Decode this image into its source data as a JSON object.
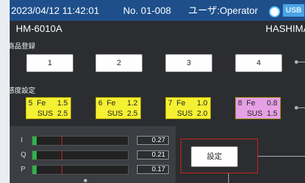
{
  "statusbar": {
    "datetime": "2023/04/12 11:42:01",
    "number": "No. 01-008",
    "user": "ユーザ:Operator",
    "usb_label": "USB"
  },
  "header": {
    "model": "HM-6010A",
    "brand": "HASHIMA"
  },
  "products": {
    "label": "商品登録",
    "buttons": [
      "1",
      "2",
      "3",
      "4"
    ]
  },
  "sensitivity": {
    "label": "感度設定",
    "items": [
      {
        "num": "5",
        "fe_label": "Fe",
        "fe": "1.5",
        "sus_label": "SUS",
        "sus": "2.5",
        "color": "#f5f032"
      },
      {
        "num": "6",
        "fe_label": "Fe",
        "fe": "1.2",
        "sus_label": "SUS",
        "sus": "2.5",
        "color": "#f5f032"
      },
      {
        "num": "7",
        "fe_label": "Fe",
        "fe": "1.0",
        "sus_label": "SUS",
        "sus": "2.0",
        "color": "#f5f032"
      },
      {
        "num": "8",
        "fe_label": "Fe",
        "fe": "0.8",
        "sus_label": "SUS",
        "sus": "1.5",
        "color": "#e6a0e6"
      }
    ]
  },
  "signals": [
    {
      "label": "I",
      "value": "0.27",
      "level": 0.04
    },
    {
      "label": "Q",
      "value": "0.21",
      "level": 0.04
    },
    {
      "label": "P",
      "value": "0.17",
      "level": 0.04
    }
  ],
  "settings_button": "設定",
  "colors": {
    "statusbar": "#1e4f8b",
    "screen": "#2b2d30",
    "signal_fill": "#2fb34a",
    "highlight": "#d62020"
  }
}
